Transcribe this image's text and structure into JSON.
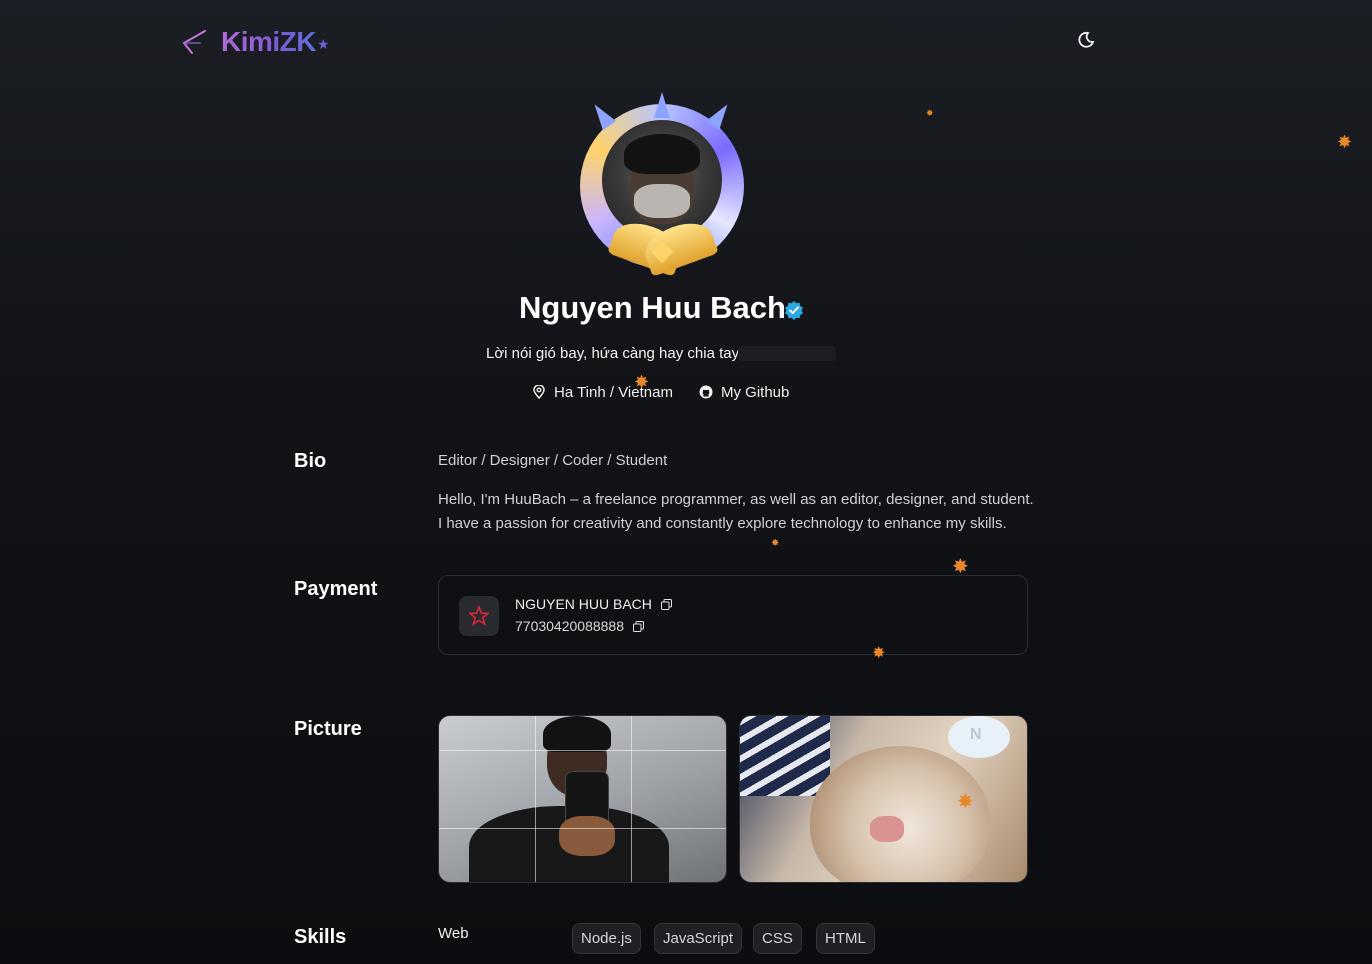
{
  "brand": {
    "logo_text": "KimiZK",
    "logo_star": "★"
  },
  "profile": {
    "name": "Nguyen Huu Bach",
    "verified": true,
    "tagline": "Lời nói gió bay, hứa càng hay chia tay",
    "location": "Ha Tinh / Vietnam",
    "github_label": "My Github"
  },
  "sections": {
    "bio_label": "Bio",
    "payment_label": "Payment",
    "picture_label": "Picture",
    "skills_label": "Skills"
  },
  "bio": {
    "role": "Editor / Designer / Coder / Student",
    "text": "Hello, I'm HuuBach – a freelance programmer, as well as an editor, designer, and student. I have a passion for creativity and constantly explore technology to enhance my skills."
  },
  "payment": {
    "account_name": "NGUYEN HUU BACH",
    "account_number": "77030420088888"
  },
  "skills": {
    "group": "Web",
    "chips": [
      "Node.js",
      "JavaScript",
      "CSS",
      "HTML"
    ]
  },
  "colors": {
    "background": "#0c0d10",
    "accent_logo": "#9b63d8",
    "verified": "#2aa9e0",
    "leaf": "#e9882b"
  },
  "icons": [
    "back-arrow-icon",
    "moon-icon",
    "verified-icon",
    "location-pin-icon",
    "github-icon",
    "star-bank-icon",
    "copy-icon",
    "maple-leaf-icon"
  ]
}
